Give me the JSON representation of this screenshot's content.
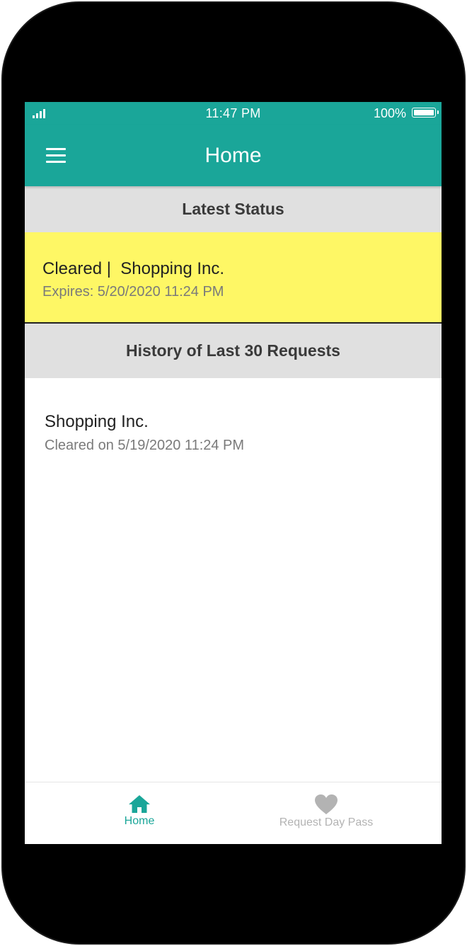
{
  "status_bar": {
    "time": "11:47 PM",
    "battery": "100%"
  },
  "header": {
    "title": "Home",
    "menu_icon": "hamburger-menu-icon"
  },
  "latest_status": {
    "heading": "Latest Status",
    "line1": "Cleared |  Shopping Inc.",
    "line2": "Expires: 5/20/2020 11:24 PM",
    "background_color": "#fef765"
  },
  "history": {
    "heading": "History of Last 30 Requests",
    "items": [
      {
        "name": "Shopping Inc.",
        "detail": "Cleared on 5/19/2020 11:24 PM"
      }
    ]
  },
  "tab_bar": {
    "tabs": [
      {
        "label": "Home",
        "icon": "home-icon",
        "active": true
      },
      {
        "label": "Request Day Pass",
        "icon": "heart-icon",
        "active": false
      }
    ]
  },
  "colors": {
    "accent": "#1aa699",
    "section_header_bg": "#e0e0e0",
    "inactive_tab": "#b3b3b3"
  }
}
